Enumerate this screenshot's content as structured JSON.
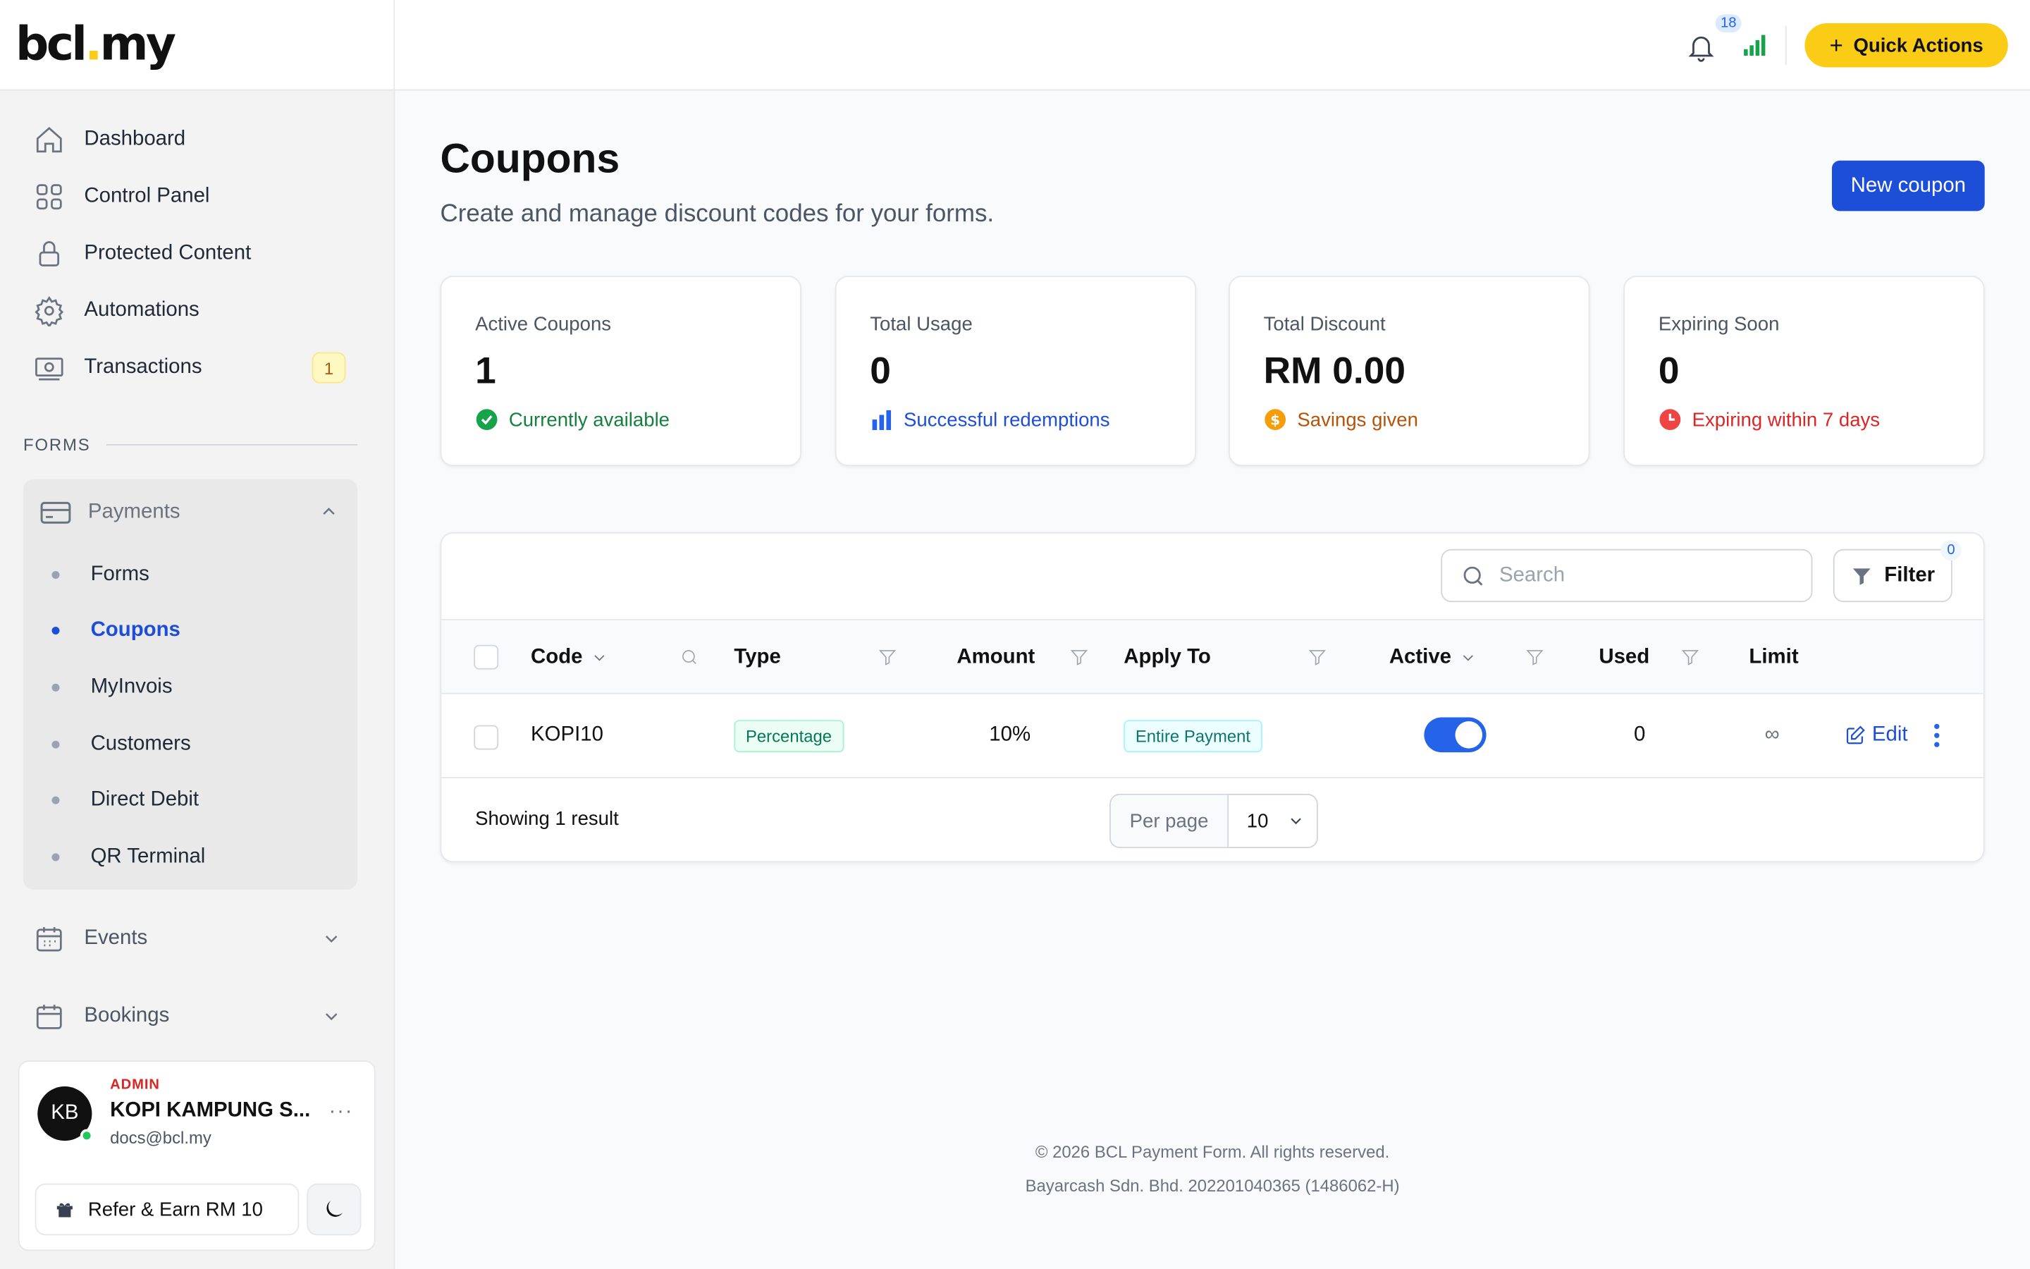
{
  "brand": {
    "logo_left": "bcl",
    "logo_dot": ".",
    "logo_right": "my"
  },
  "sidebar": {
    "items": [
      {
        "label": "Dashboard"
      },
      {
        "label": "Control Panel"
      },
      {
        "label": "Protected Content"
      },
      {
        "label": "Automations"
      },
      {
        "label": "Transactions",
        "badge": "1"
      }
    ],
    "section_label": "FORMS",
    "payments": {
      "label": "Payments",
      "sub_items": [
        {
          "label": "Forms"
        },
        {
          "label": "Coupons",
          "active": true
        },
        {
          "label": "MyInvois"
        },
        {
          "label": "Customers"
        },
        {
          "label": "Direct Debit"
        },
        {
          "label": "QR Terminal"
        }
      ]
    },
    "events_label": "Events",
    "bookings_label": "Bookings",
    "user": {
      "initials": "KB",
      "role": "ADMIN",
      "name": "KOPI KAMPUNG S...",
      "email": "docs@bcl.my",
      "more": "···"
    },
    "refer_label": "Refer & Earn RM 10"
  },
  "topbar": {
    "notification_count": "18",
    "quick_actions_label": "Quick Actions",
    "quick_actions_plus": "+"
  },
  "page": {
    "title": "Coupons",
    "subtitle": "Create and manage discount codes for your forms.",
    "new_button": "New coupon"
  },
  "stats": [
    {
      "label": "Active Coupons",
      "value": "1",
      "note": "Currently available",
      "note_color": "#15803d"
    },
    {
      "label": "Total Usage",
      "value": "0",
      "note": "Successful redemptions",
      "note_color": "#1d4ed8"
    },
    {
      "label": "Total Discount",
      "value": "RM 0.00",
      "note": "Savings given",
      "note_color": "#b45309"
    },
    {
      "label": "Expiring Soon",
      "value": "0",
      "note": "Expiring within 7 days",
      "note_color": "#dc2626"
    }
  ],
  "table": {
    "search_placeholder": "Search",
    "filter_label": "Filter",
    "filter_count": "0",
    "columns": [
      "Code",
      "Type",
      "Amount",
      "Apply To",
      "Active",
      "Used",
      "Limit"
    ],
    "rows": [
      {
        "code": "KOPI10",
        "type": "Percentage",
        "amount": "10%",
        "apply_to": "Entire Payment",
        "active": true,
        "used": "0",
        "limit": "∞",
        "edit": "Edit"
      }
    ],
    "showing": "Showing 1 result",
    "per_page_label": "Per page",
    "per_page_value": "10"
  },
  "footer": {
    "copyright": "© 2026 BCL Payment Form. All rights reserved.",
    "company": "Bayarcash Sdn. Bhd. 202201040365 (1486062-H)"
  },
  "colors": {
    "accent": "#1d4ed8",
    "quick_actions": "#facc15"
  }
}
